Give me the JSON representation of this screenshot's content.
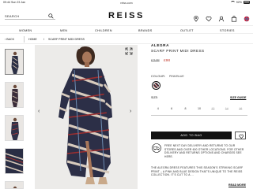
{
  "status_bar": {
    "time": "09:44",
    "date": "Sun 23 Jan",
    "url": "reiss.com",
    "battery": "92%"
  },
  "header": {
    "logo": "REISS",
    "search_placeholder": "SEARCH",
    "icons": [
      "search-icon",
      "location-icon",
      "heart-icon",
      "user-icon",
      "bag-icon",
      "globe-icon"
    ]
  },
  "nav": {
    "items": [
      "WOMEN",
      "MEN",
      "CHILDREN",
      "BRANDS",
      "OUTLET",
      "STORIES"
    ]
  },
  "breadcrumb": {
    "back": "BACK",
    "home": "HOME",
    "separator": "/",
    "current": "SCARF PRINT MIDI DRESS"
  },
  "product": {
    "brand": "ALEGRA",
    "name": "SCARF PRINT MIDI DRESS",
    "price_old": "£248",
    "price_new": "£98",
    "colour_label": "COLOUR:",
    "colour_value": "PINK/BLUE",
    "size_label": "SIZE:",
    "size_guide": "SIZE GUIDE",
    "sizes": [
      {
        "label": "4",
        "available": true
      },
      {
        "label": "6",
        "available": true
      },
      {
        "label": "8",
        "available": true
      },
      {
        "label": "10",
        "available": true
      },
      {
        "label": "12",
        "available": false
      },
      {
        "label": "14",
        "available": false
      },
      {
        "label": "16",
        "available": false
      }
    ],
    "add_to_bag": "ADD TO BAG",
    "delivery_text": "FREE NEXT DAY DELIVERY AND RETURNS TO OUR STORES AND OVER 600 OTHER LOCATIONS. FOR OTHER DELIVERY AND RETURNS OPTIONS AND CHARGES SEE HERE.",
    "description": "THE ALEGRA DRESS FEATURES THIS SEASON'S STRIKING SCARF PRINT – A PINK AND BLUE DESIGN THAT'S UNIQUE TO THE REISS COLLECTION. IT'S CUT TO A ...",
    "read_more": "READ MORE"
  },
  "colors": {
    "sale_red": "#c0392b",
    "button_black": "#111111"
  }
}
